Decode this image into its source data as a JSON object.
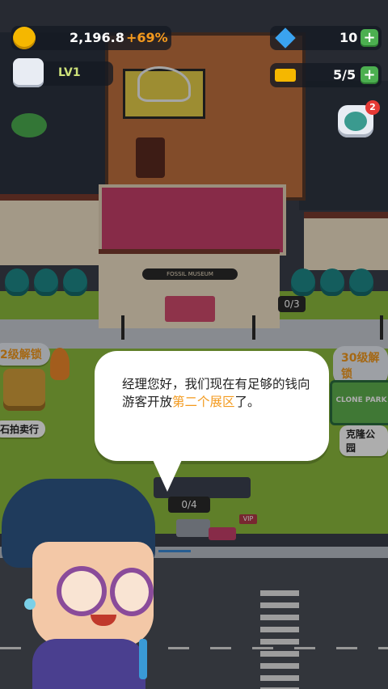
{
  "hud": {
    "coins_value": "2,196.8",
    "coins_bonus": "+69%",
    "gems_value": "10",
    "tickets_value": "5/5",
    "level_label": "LV1",
    "menu_badge": "2",
    "plus_symbol": "+"
  },
  "map": {
    "museum_sign": "FOSSIL MUSEUM",
    "parking_counter": "0/3",
    "bus_stop_counter": "0/4",
    "vip_label": "VIP",
    "clone_park_sign": "CLONE PARK"
  },
  "locations": {
    "left_lock_label": "2级解锁",
    "left_building_name": "石拍卖行",
    "right_lock_label": "30级解锁",
    "right_building_name": "克隆公园"
  },
  "dialog": {
    "text_part1": "经理您好，我们现在有足够的钱向游客开放",
    "text_highlight": "第二个展区",
    "text_part2": "了。"
  },
  "colors": {
    "highlight": "#f39a1e",
    "plus_green": "#4caf50",
    "coin_gold": "#f5b700",
    "gem_blue": "#3aa3f0",
    "hair_navy": "#1f3b5c"
  }
}
